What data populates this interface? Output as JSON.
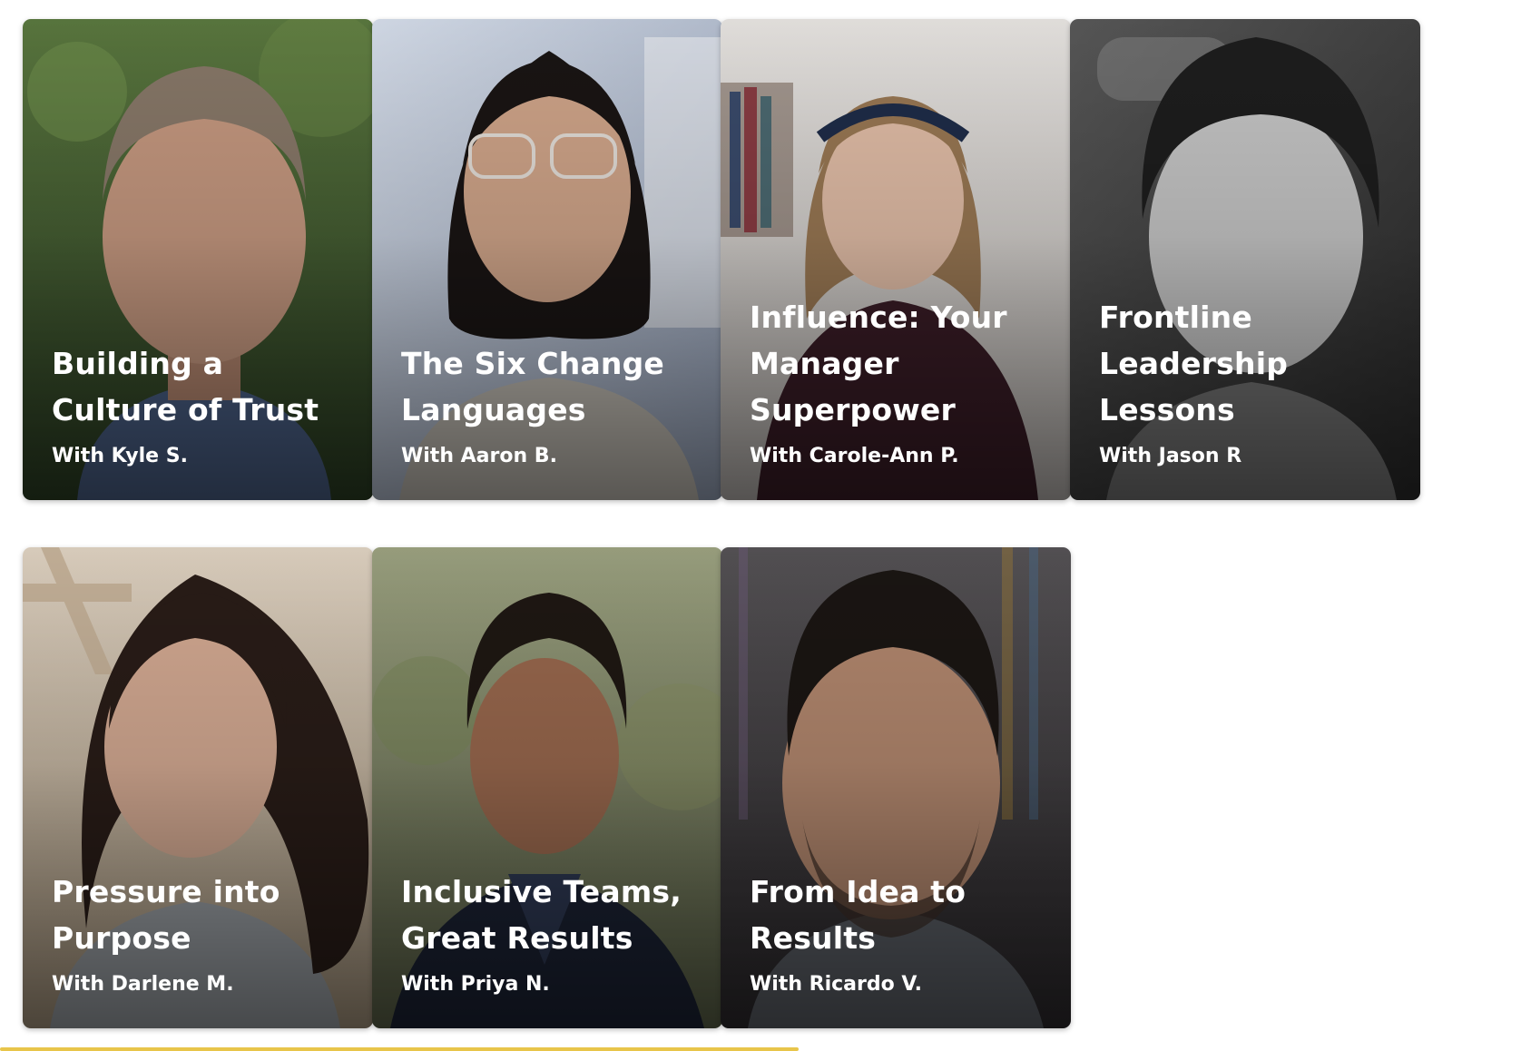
{
  "courses": [
    {
      "title": "Building a Culture of Trust",
      "byline": "With Kyle S.",
      "palette": {
        "bg1": "#4f6b3a",
        "bg2": "#2c3f24",
        "skin": "#c99b82",
        "hair": "#8a7a6a",
        "shirt": "#4c6289"
      }
    },
    {
      "title": "The Six Change Languages",
      "byline": "With Aaron B.",
      "palette": {
        "bg1": "#cfd8e6",
        "bg2": "#8e9cb5",
        "skin": "#d4a88c",
        "hair": "#1a1514",
        "shirt": "#c7c2b9"
      }
    },
    {
      "title": "Influence: Your Manager Superpower",
      "byline": "With Carole-Ann P.",
      "palette": {
        "bg1": "#e6e3e0",
        "bg2": "#bdb8b4",
        "skin": "#e6c1aa",
        "hair": "#9c7a55",
        "shirt": "#3b1d27"
      }
    },
    {
      "title": "Frontline Leadership Lessons",
      "byline": "With Jason R",
      "palette": {
        "bg1": "#8a8a8a",
        "bg2": "#3e3e3e",
        "skin": "#c9c9c9",
        "hair": "#1e1e1e",
        "shirt": "#777777"
      }
    },
    {
      "title": "Pressure into Purpose",
      "byline": "With Darlene M.",
      "palette": {
        "bg1": "#d8c9b6",
        "bg2": "#a8977f",
        "skin": "#d8ad95",
        "hair": "#2a1d18",
        "shirt": "#9ea3a8"
      }
    },
    {
      "title": "Inclusive Teams, Great Results",
      "byline": "With Priya N.",
      "palette": {
        "bg1": "#8d9470",
        "bg2": "#5b6248",
        "skin": "#9c6a4f",
        "hair": "#1f1813",
        "shirt": "#1c2335"
      }
    },
    {
      "title": "From Idea to Results",
      "byline": "With Ricardo V.",
      "palette": {
        "bg1": "#4d4a4c",
        "bg2": "#2d2a2d",
        "skin": "#b68a70",
        "hair": "#1b1613",
        "shirt": "#5d6168"
      }
    }
  ],
  "accent_color": "#e8c54a"
}
